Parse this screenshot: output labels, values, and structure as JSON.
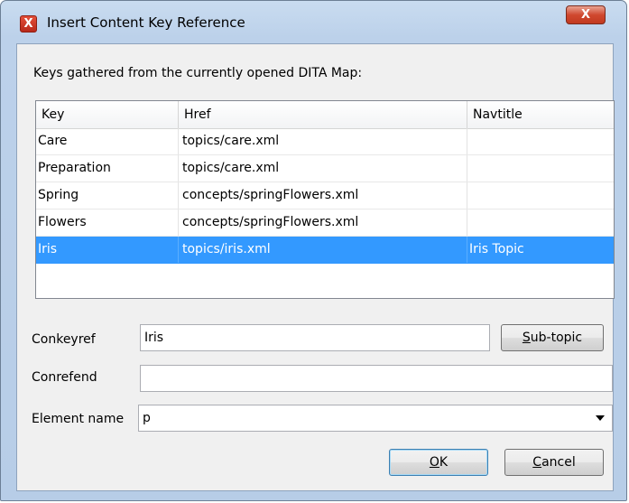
{
  "window": {
    "title": "Insert Content Key Reference",
    "app_icon_glyph": "X",
    "close_glyph": "X"
  },
  "description": "Keys gathered from the currently opened DITA Map:",
  "table": {
    "columns": [
      "Key",
      "Href",
      "Navtitle"
    ],
    "rows": [
      {
        "key": "Care",
        "href": "topics/care.xml",
        "navtitle": ""
      },
      {
        "key": "Preparation",
        "href": "topics/care.xml",
        "navtitle": ""
      },
      {
        "key": "Spring",
        "href": "concepts/springFlowers.xml",
        "navtitle": ""
      },
      {
        "key": "Flowers",
        "href": "concepts/springFlowers.xml",
        "navtitle": ""
      },
      {
        "key": "Iris",
        "href": "topics/iris.xml",
        "navtitle": "Iris Topic"
      }
    ],
    "selected_row": 4
  },
  "form": {
    "conkeyref_label": "Conkeyref",
    "conkeyref_value": "Iris",
    "subtopic_button": "Sub-topic",
    "conrefend_label": "Conrefend",
    "conrefend_value": "",
    "element_name_label": "Element name",
    "element_name_value": "p"
  },
  "buttons": {
    "ok": "OK",
    "cancel": "Cancel"
  },
  "colors": {
    "selection": "#3399ff",
    "close_button": "#c23a20"
  }
}
